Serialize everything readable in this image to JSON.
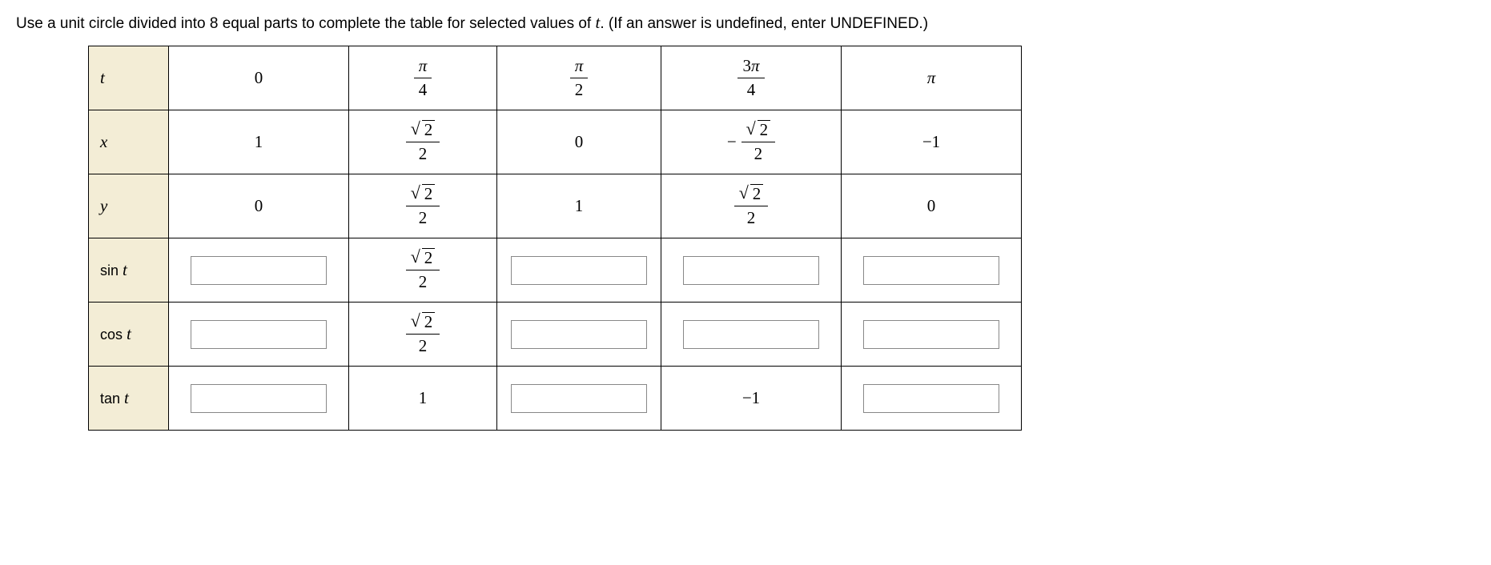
{
  "instruction": {
    "prefix": "Use a unit circle divided into 8 equal parts to complete the table for selected values of ",
    "var": "t",
    "suffix": ". (If an answer is undefined, enter UNDEFINED.)"
  },
  "rowLabels": {
    "t": "t",
    "x": "x",
    "y": "y",
    "sin": "sin",
    "cos": "cos",
    "tan": "tan",
    "trigVar": "t"
  },
  "headerCols": {
    "c0": "0",
    "c1_num": "π",
    "c1_den": "4",
    "c2_num": "π",
    "c2_den": "2",
    "c3_coef": "3",
    "c3_num": "π",
    "c3_den": "4",
    "c4": "π"
  },
  "xRow": {
    "c0": "1",
    "c1_rad": "2",
    "c1_den": "2",
    "c2": "0",
    "c3_rad": "2",
    "c3_den": "2",
    "c4": "−1"
  },
  "yRow": {
    "c0": "0",
    "c1_rad": "2",
    "c1_den": "2",
    "c2": "1",
    "c3_rad": "2",
    "c3_den": "2",
    "c4": "0"
  },
  "sinRow": {
    "c1_rad": "2",
    "c1_den": "2"
  },
  "cosRow": {
    "c1_rad": "2",
    "c1_den": "2"
  },
  "tanRow": {
    "c1": "1",
    "c3": "−1"
  },
  "chart_data": {
    "type": "table",
    "title": "Unit circle table for selected values of t",
    "columns": [
      "t",
      "0",
      "π/4",
      "π/2",
      "3π/4",
      "π"
    ],
    "rows": [
      {
        "label": "x",
        "values": [
          "1",
          "√2/2",
          "0",
          "−√2/2",
          "−1"
        ]
      },
      {
        "label": "y",
        "values": [
          "0",
          "√2/2",
          "1",
          "√2/2",
          "0"
        ]
      },
      {
        "label": "sin t",
        "values": [
          "",
          "√2/2",
          "",
          "",
          ""
        ],
        "inputs": [
          true,
          false,
          true,
          true,
          true
        ]
      },
      {
        "label": "cos t",
        "values": [
          "",
          "√2/2",
          "",
          "",
          ""
        ],
        "inputs": [
          true,
          false,
          true,
          true,
          true
        ]
      },
      {
        "label": "tan t",
        "values": [
          "",
          "1",
          "",
          "−1",
          ""
        ],
        "inputs": [
          true,
          false,
          true,
          false,
          true
        ]
      }
    ]
  }
}
